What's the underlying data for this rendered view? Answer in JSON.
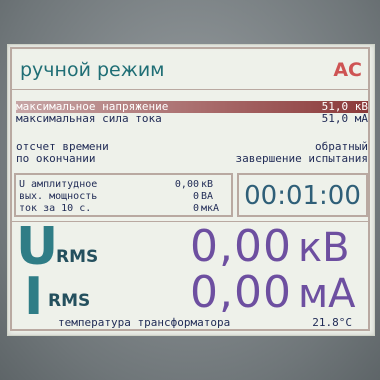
{
  "header": {
    "mode_title": "ручной режим",
    "mode_code": "AC"
  },
  "params": [
    {
      "label": "максимальное напряжение",
      "value": "51,0 кВ",
      "selected": true
    },
    {
      "label": "максимальная сила тока",
      "value": "51,0 мА",
      "selected": false
    }
  ],
  "timer_settings": [
    {
      "label": "отсчет времени",
      "value": "обратный"
    },
    {
      "label": "по окончании",
      "value": "завершение испытания"
    }
  ],
  "measurements": [
    {
      "label": "U амплитудное",
      "value": "0,00",
      "unit": "кВ"
    },
    {
      "label": "вых. мощность",
      "value": "0",
      "unit": "ВА"
    },
    {
      "label": "ток за 10 с.",
      "value": "0",
      "unit": "мкА"
    }
  ],
  "timer": "00:01:00",
  "voltage": {
    "symbol": "U",
    "sub": "RMS",
    "value": "0,00",
    "unit": "кВ"
  },
  "current": {
    "symbol": "I",
    "sub": "RMS",
    "value": "0,00",
    "unit": "мА"
  },
  "footer": {
    "label": "температура трансформатора",
    "value": "21.8°C"
  },
  "colors": {
    "accent": "#1f6e75",
    "mode": "#ce5454",
    "values": "#6d4fa0",
    "selection": "#8b3a3a"
  }
}
